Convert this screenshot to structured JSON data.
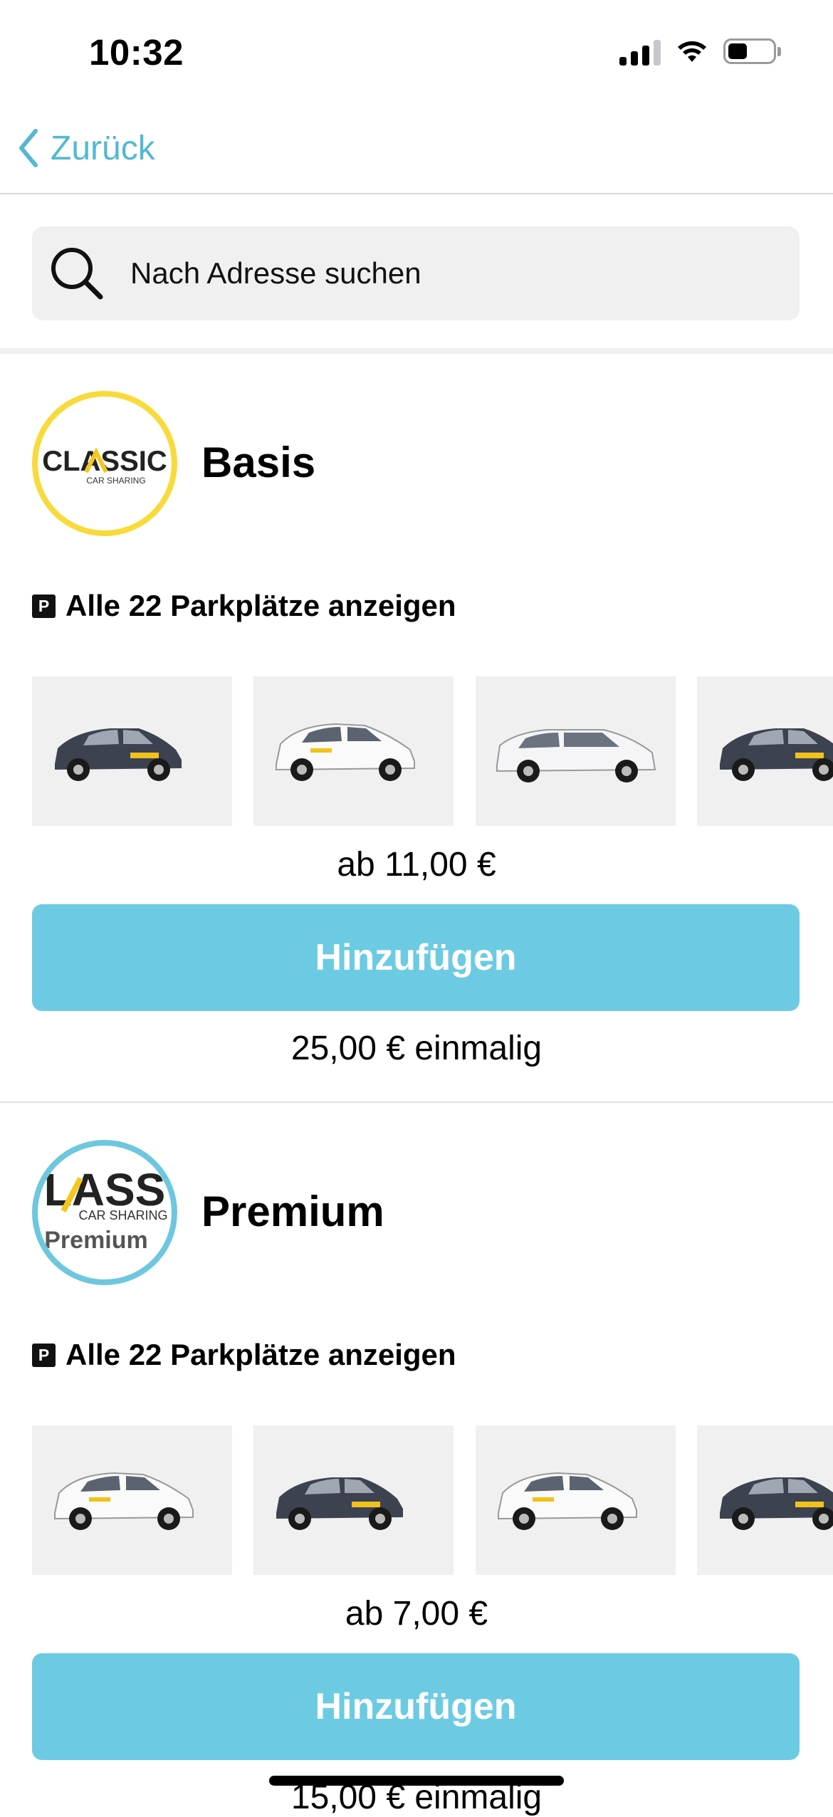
{
  "status": {
    "time": "10:32"
  },
  "nav": {
    "back_label": "Zurück"
  },
  "search": {
    "placeholder": "Nach Adresse suchen"
  },
  "plans": [
    {
      "name": "Basis",
      "logo": {
        "brand_text": "CLASSIC",
        "sub_text": "CAR SHARING",
        "ring_color": "#f8da3a"
      },
      "parking_label": "Alle 22 Parkplätze anzeigen",
      "cars": [
        "dark-hatchback",
        "white-hatchback",
        "white-estate",
        "dark-hatchback"
      ],
      "price_from": "ab 11,00 €",
      "add_label": "Hinzufügen",
      "price_once": "25,00 € einmalig"
    },
    {
      "name": "Premium",
      "logo": {
        "brand_text": "LASS",
        "sub_text": "CAR SHARING",
        "tier_text": "Premium",
        "ring_color": "#6dc7df"
      },
      "parking_label": "Alle 22 Parkplätze anzeigen",
      "cars": [
        "white-hatchback",
        "dark-hatchback",
        "white-hatchback",
        "dark-hatchback"
      ],
      "price_from": "ab 7,00 €",
      "add_label": "Hinzufügen",
      "price_once": "15,00 € einmalig"
    }
  ],
  "colors": {
    "accent": "#53b8d2",
    "button": "#6ccbe3",
    "card_bg": "#f0f0f0"
  }
}
